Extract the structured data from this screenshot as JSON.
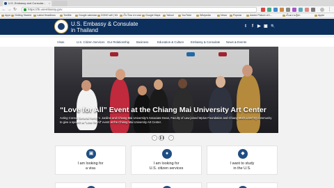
{
  "browser": {
    "tabs": [
      {
        "label": "U.S. Embassy and Consular..."
      },
      {
        "label": ""
      }
    ],
    "url": "https://th.usembassy.gov",
    "bookmarks": [
      "Apps",
      "Getting Started",
      "Latest Headlines",
      "TextMe",
      "Google calendar",
      "DONG will | Mr.",
      "เว็บ ไทย ประเทศ",
      "Google Maps",
      "Yahoo!",
      "YouTube",
      "Wikipedia",
      "News",
      "Popular",
      "Adobe Picture of t...",
      "เก็บความรู้ค่ะ",
      "Apple"
    ]
  },
  "site": {
    "title_line1": "U.S. Embassy & Consulate",
    "title_line2": "in Thailand",
    "social": [
      "t",
      "f",
      "▶",
      "▣",
      "🔍"
    ]
  },
  "nav": {
    "items": [
      "Visas",
      "U.S. Citizen Services",
      "Our Relationship",
      "Business",
      "Education & Culture",
      "Embassy & Consulate",
      "News & Events"
    ]
  },
  "hero": {
    "title": "“Love for All” Event at the Chiang Mai University Art Center",
    "caption": "Acting Consul General Henry V. Jardine and Chiang Mai University's Associate Dean, Faculty of Law joined Mplus Foundation and Chiang Mai's LGBTIQ community to give a speech at \"Love for All\" event at the Chiang Mai University Art Center."
  },
  "carousel": {
    "prev": "‹",
    "pause": "❚❚",
    "next": "›"
  },
  "cards": [
    {
      "line1": "I am looking for",
      "line2": "a visa",
      "icon": "passport-icon"
    },
    {
      "line1": "I am looking for",
      "line2": "U.S. citizen services",
      "icon": "citizen-icon"
    },
    {
      "line1": "I want to study",
      "line2": "in the U.S.",
      "icon": "graduation-cap-icon"
    }
  ]
}
